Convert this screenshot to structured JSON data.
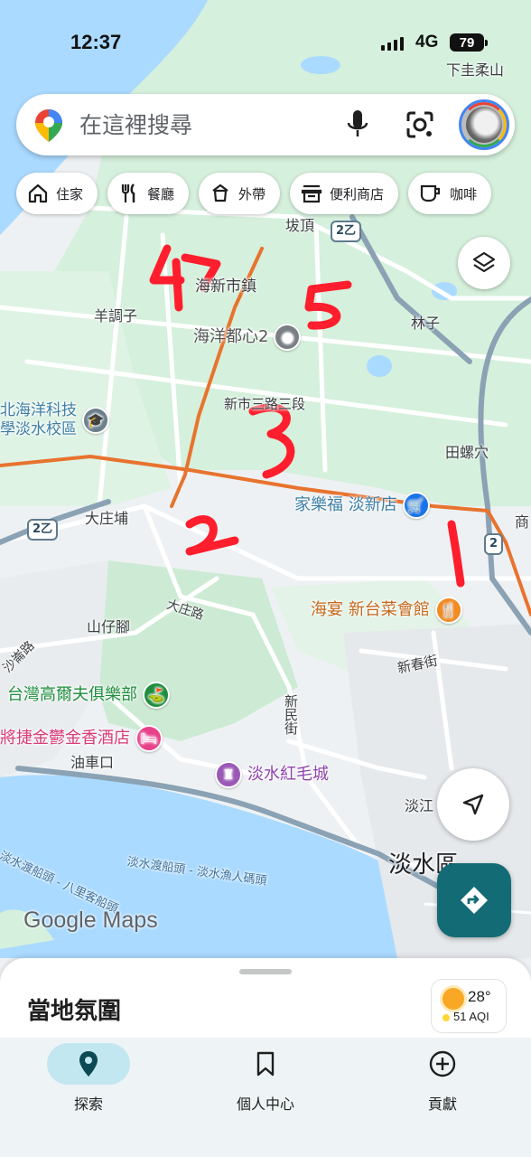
{
  "status_bar": {
    "time": "12:37",
    "network": "4G",
    "battery": "79"
  },
  "search": {
    "placeholder": "在這裡搜尋"
  },
  "chips": [
    {
      "icon": "home-icon",
      "label": "住家"
    },
    {
      "icon": "restaurant-icon",
      "label": "餐廳"
    },
    {
      "icon": "takeout-icon",
      "label": "外帶"
    },
    {
      "icon": "store-icon",
      "label": "便利商店"
    },
    {
      "icon": "coffee-icon",
      "label": "咖啡"
    }
  ],
  "map": {
    "places": {
      "xiaguirou": "下圭柔山",
      "bading": "坺頂",
      "haixin": "海新市鎮",
      "yangtiaozi": "羊調子",
      "haiyang": "海洋都心2",
      "linzi": "林子",
      "xinshi": "新市三路三段",
      "school": "北海洋科技\n學淡水校區",
      "tianluoxue": "田螺穴",
      "carrefour": "家樂福 淡新店",
      "dazhuangpu": "大庄埔",
      "dazhuanglu": "大庄路",
      "shanzijiao": "山仔腳",
      "restaurant": "海宴 新台菜會館",
      "xinchun": "新春街",
      "golf": "台灣高爾夫俱樂部",
      "hotel": "將捷金鬱金香酒店",
      "youchekou": "油車口",
      "xinmin": "新民街",
      "redcastle": "淡水紅毛城",
      "danjiang": "淡江",
      "tamsui": "淡水區",
      "ferry": "淡水渡船頭 - 淡水漁人碼頭",
      "ferry2": "淡水渡船頭 - 八里客船頭",
      "shamaolu": "沙崙路",
      "shang": "商",
      "route2a": "2乙",
      "route2": "2"
    },
    "annotations": [
      "1",
      "2",
      "3",
      "4",
      "5"
    ]
  },
  "branding": {
    "logo": "Google Maps"
  },
  "sheet": {
    "title": "當地氛圍",
    "temp": "28°",
    "aqi": "51 AQI"
  },
  "nav": [
    {
      "label": "探索",
      "active": true
    },
    {
      "label": "個人中心",
      "active": false
    },
    {
      "label": "貢獻",
      "active": false
    }
  ],
  "colors": {
    "accent": "#126b75",
    "annotation": "#ff1e2d",
    "road": "#e8732e",
    "land": "#d9f0e2",
    "water": "#aadaff"
  }
}
